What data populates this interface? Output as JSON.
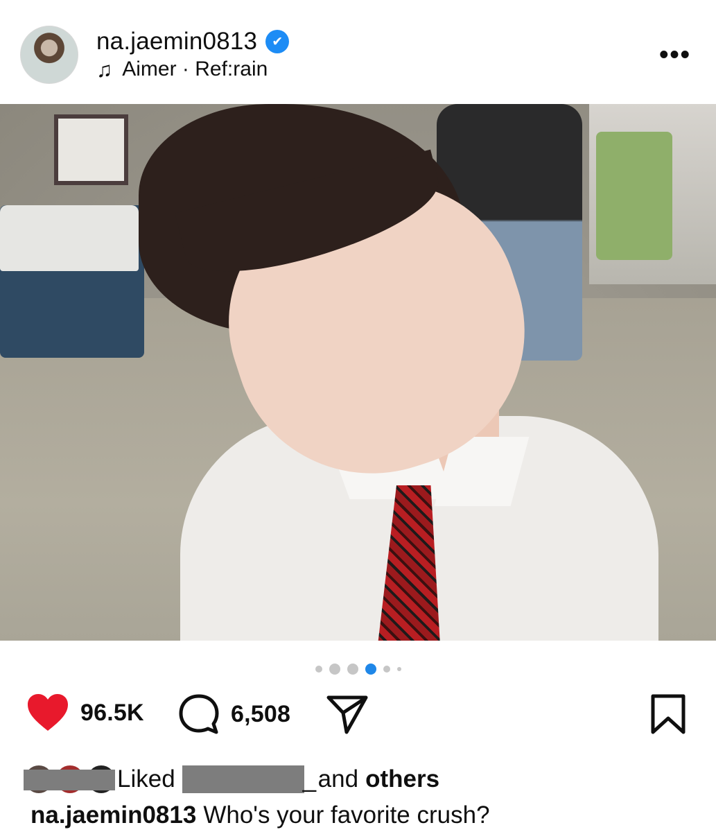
{
  "post": {
    "username": "na.jaemin0813",
    "verified_mark": "✔",
    "music_text": "Aimer · Ref:rain",
    "more_label": "•••"
  },
  "carousel": {
    "total": 6,
    "active": 3
  },
  "actions": {
    "likes": "96.5K",
    "comments": "6,508"
  },
  "liked_by": {
    "prefix": "Liked",
    "redacted_suffix": "_",
    "and_text": "and",
    "others": "others"
  },
  "caption": {
    "username": "na.jaemin0813",
    "text": "Who's your favorite crush?"
  },
  "colors": {
    "heart": "#e8192c",
    "verified": "#1d8cf5",
    "active_dot": "#1f87e8"
  },
  "icons": [
    "music-note-icon",
    "more-icon",
    "mute-icon",
    "heart-icon",
    "comment-icon",
    "share-icon",
    "bookmark-icon"
  ]
}
